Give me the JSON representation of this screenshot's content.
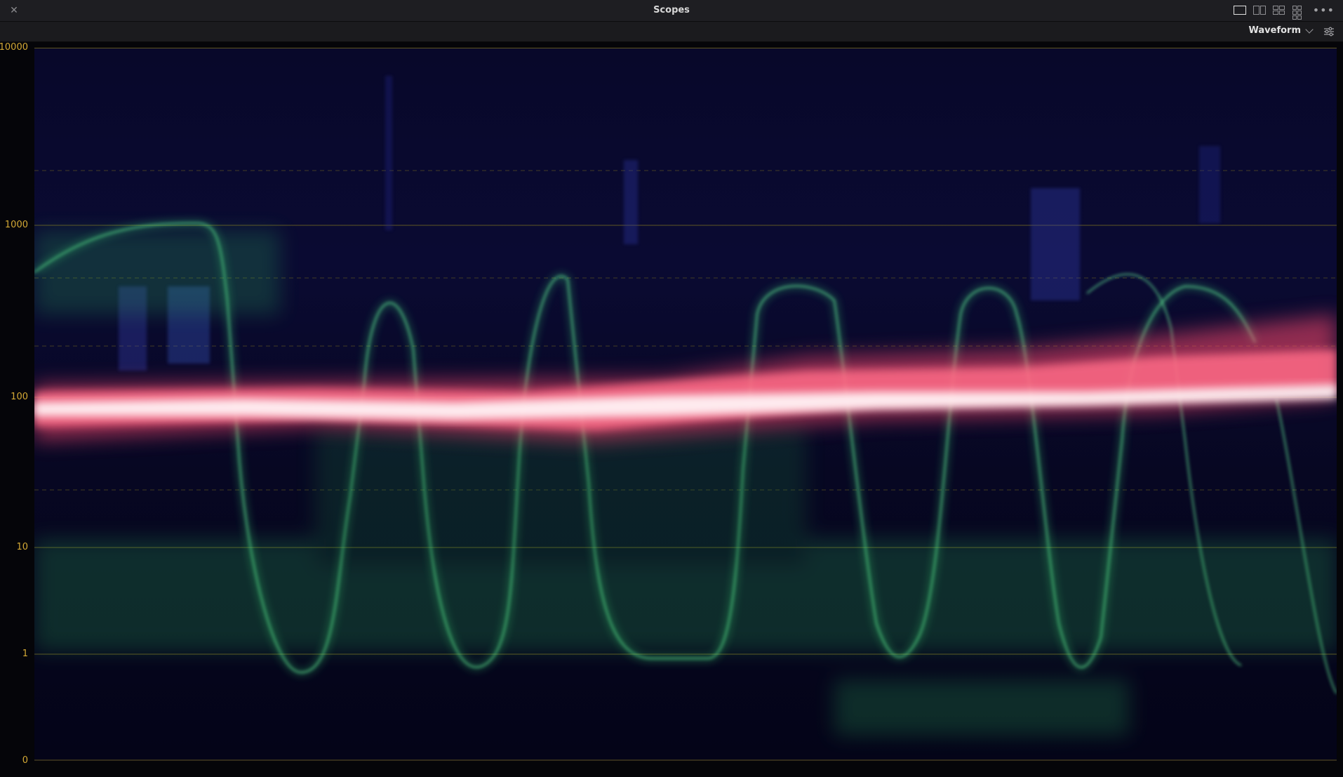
{
  "window": {
    "title": "Scopes",
    "close_icon": "close-icon",
    "layout_icons": [
      "single-layout-icon",
      "dual-layout-icon",
      "quad-layout-icon",
      "multi-layout-icon"
    ],
    "more_icon": "more-icon"
  },
  "toolbar": {
    "scope_type": "Waveform",
    "settings_icon": "settings-icon"
  },
  "scope": {
    "y_axis_labels": [
      "10000",
      "1000",
      "100",
      "10",
      "1",
      "0"
    ],
    "colors": {
      "axis_label": "#d4a935",
      "graticule": "#6f6420",
      "background": "#07072a",
      "green_trace": "#3ee07a",
      "red_trace": "#ff4a6e"
    }
  }
}
